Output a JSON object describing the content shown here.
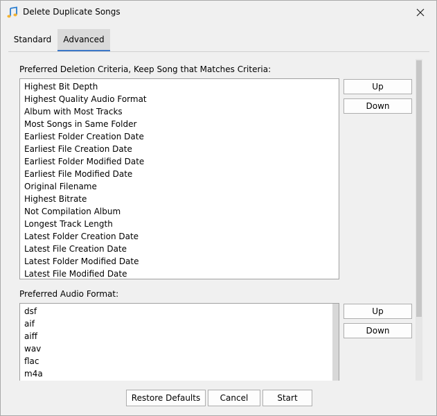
{
  "window": {
    "title": "Delete Duplicate Songs",
    "app_icon": "music-note-icon",
    "close_icon": "close-icon"
  },
  "tabs": [
    {
      "label": "Standard",
      "selected": false
    },
    {
      "label": "Advanced",
      "selected": true
    }
  ],
  "deletion_criteria": {
    "label": "Preferred Deletion Criteria, Keep Song that Matches Criteria:",
    "items": [
      "Highest Bit Depth",
      "Highest Quality Audio Format",
      "Album with Most Tracks",
      "Most Songs in Same Folder",
      "Earliest Folder Creation Date",
      "Earliest File Creation Date",
      "Earliest Folder Modified Date",
      "Earliest File Modified Date",
      "Original Filename",
      "Highest Bitrate",
      "Not Compilation Album",
      "Longest Track Length",
      "Latest Folder Creation Date",
      "Latest File Creation Date",
      "Latest Folder Modified Date",
      "Latest File Modified Date"
    ],
    "up_label": "Up",
    "down_label": "Down"
  },
  "audio_format": {
    "label": "Preferred Audio Format:",
    "items": [
      "dsf",
      "aif",
      "aiff",
      "wav",
      "flac",
      "m4a"
    ],
    "up_label": "Up",
    "down_label": "Down"
  },
  "footer": {
    "restore_label": "Restore Defaults",
    "cancel_label": "Cancel",
    "start_label": "Start"
  },
  "colors": {
    "background": "#f0f0f0",
    "tab_selected_bg": "#dadada",
    "tab_accent": "#3b77c8"
  }
}
